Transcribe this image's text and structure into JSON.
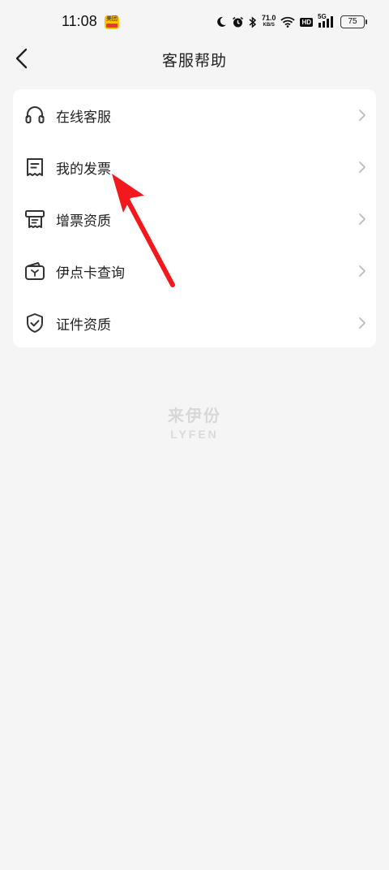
{
  "status_bar": {
    "time": "11:08",
    "app_badge": "美团",
    "net_speed": "71.0",
    "net_speed_unit": "KB/S",
    "hd": "HD",
    "signal": "5G",
    "battery": "75"
  },
  "header": {
    "title": "客服帮助"
  },
  "menu": {
    "items": [
      {
        "label": "在线客服",
        "icon": "headset-icon"
      },
      {
        "label": "我的发票",
        "icon": "receipt-icon"
      },
      {
        "label": "增票资质",
        "icon": "printer-receipt-icon"
      },
      {
        "label": "伊点卡查询",
        "icon": "wallet-card-icon"
      },
      {
        "label": "证件资质",
        "icon": "shield-check-icon"
      }
    ]
  },
  "watermark": {
    "cn": "来伊份",
    "en": "LYFEN"
  },
  "colors": {
    "background": "#f5f5f5",
    "card": "#ffffff",
    "annotation_arrow": "#f2181c"
  }
}
